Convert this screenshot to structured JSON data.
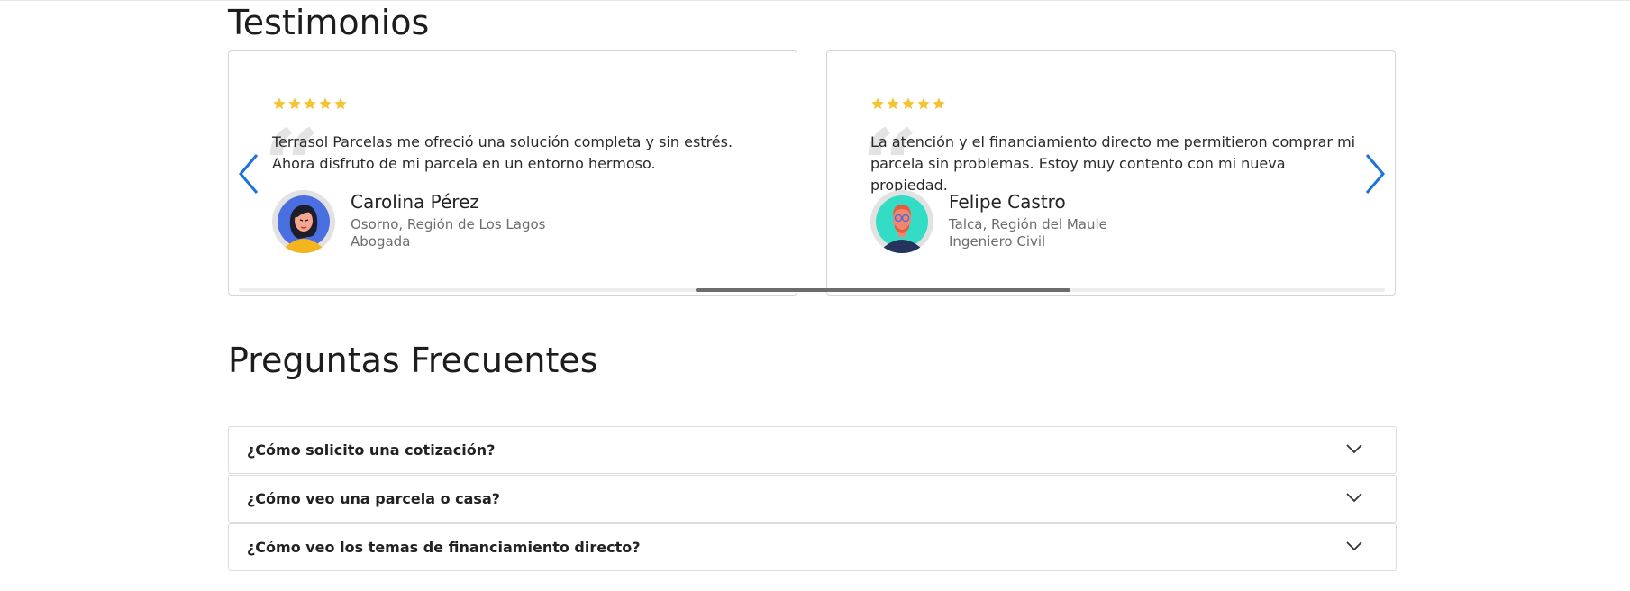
{
  "testimonials": {
    "title": "Testimonios",
    "items": [
      {
        "rating": 5,
        "stars": "★★★★★",
        "quote": "Terrasol Parcelas me ofreció una solución completa y sin estrés. Ahora disfruto de mi parcela en un entorno hermoso.",
        "name": "Carolina Pérez",
        "location": "Osorno, Región de Los Lagos",
        "profession": "Abogada",
        "avatar_icon": "woman-avatar-icon"
      },
      {
        "rating": 5,
        "stars": "★★★★★",
        "quote": "La atención y el financiamiento directo me permitieron comprar mi parcela sin problemas. Estoy muy contento con mi nueva propiedad.",
        "name": "Felipe Castro",
        "location": "Talca, Región del Maule",
        "profession": "Ingeniero Civil",
        "avatar_icon": "man-avatar-icon"
      }
    ],
    "prev_icon": "chevron-left-icon",
    "next_icon": "chevron-right-icon"
  },
  "faq": {
    "title": "Preguntas Frecuentes",
    "items": [
      {
        "question": "¿Cómo solicito una cotización?"
      },
      {
        "question": "¿Cómo veo una parcela o casa?"
      },
      {
        "question": "¿Cómo veo los temas de financiamiento directo?"
      }
    ],
    "expand_icon": "chevron-down-icon"
  },
  "colors": {
    "star": "#f4c430",
    "arrow": "#1a73d9",
    "border": "#d5d5d5"
  }
}
